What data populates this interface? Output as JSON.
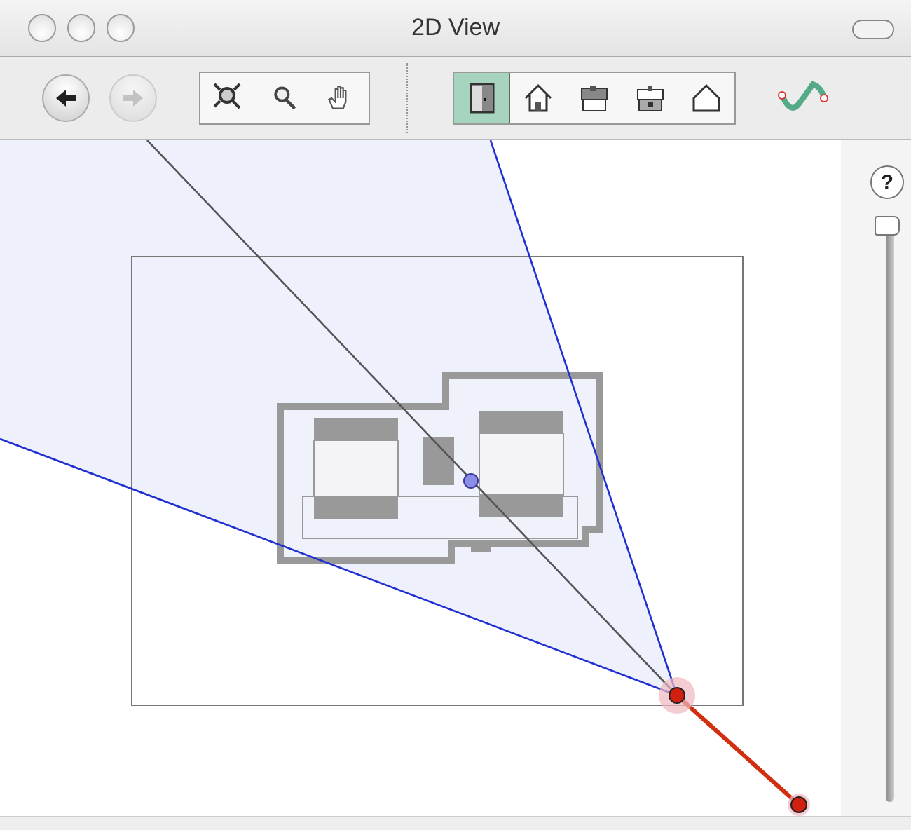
{
  "window": {
    "title": "2D View"
  },
  "nav_buttons": [
    {
      "kind": "back",
      "disabled": false
    },
    {
      "kind": "forward",
      "disabled": true
    }
  ],
  "zoom_tools": [
    {
      "kind": "zoom-fit",
      "selected": false
    },
    {
      "kind": "zoom",
      "selected": false
    },
    {
      "kind": "pan",
      "selected": false
    }
  ],
  "view_modes": [
    {
      "kind": "plan",
      "selected": true
    },
    {
      "kind": "house",
      "selected": false
    },
    {
      "kind": "roof",
      "selected": false
    },
    {
      "kind": "storey",
      "selected": false
    },
    {
      "kind": "outline",
      "selected": false
    }
  ],
  "help_button": {
    "label": "?"
  },
  "zoom_slider": {
    "level": 1
  }
}
